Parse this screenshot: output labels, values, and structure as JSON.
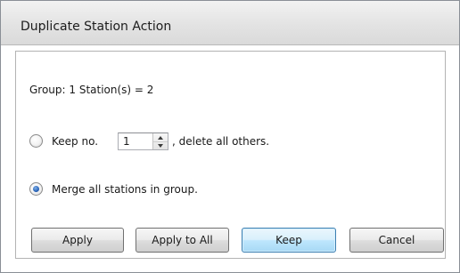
{
  "window": {
    "title": "Duplicate Station Action"
  },
  "info": {
    "group_line": "Group: 1  Station(s) = 2"
  },
  "options": {
    "keep": {
      "prefix": "Keep no.",
      "value": "1",
      "suffix": ", delete all others.",
      "selected": false
    },
    "merge": {
      "label": "Merge all stations in group.",
      "selected": true
    }
  },
  "buttons": {
    "apply": "Apply",
    "apply_all": "Apply to All",
    "keep": "Keep",
    "cancel": "Cancel"
  }
}
